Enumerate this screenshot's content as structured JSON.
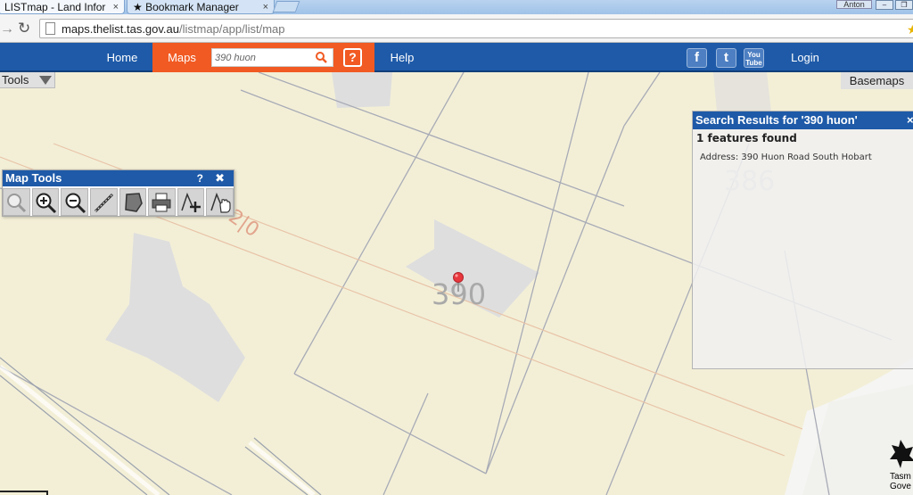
{
  "browser": {
    "tabs": [
      {
        "label": "LISTmap - Land Infor",
        "close": "×"
      },
      {
        "label": "★ Bookmark Manager",
        "close": "×"
      }
    ],
    "user_label": "Anton",
    "window_buttons": [
      "–",
      "❐"
    ],
    "url_host": "maps.thelist.tas.gov.au",
    "url_path": "/listmap/app/list/map"
  },
  "nav": {
    "home": "Home",
    "maps": "Maps",
    "search_value": "390 huon",
    "help_icon": "?",
    "help": "Help",
    "facebook": "f",
    "twitter": "t",
    "youtube": "You Tube",
    "login": "Login"
  },
  "map": {
    "tools_label": "Tools",
    "basemaps_label": "Basemaps",
    "labels": [
      "390",
      "386",
      "2|0"
    ],
    "corner_text": "Tasm\nGove"
  },
  "map_tools": {
    "title": "Map Tools",
    "help": "?",
    "close": "✖",
    "tools": [
      "identify-tool-icon",
      "zoom-in-icon",
      "zoom-out-icon",
      "measure-tool-icon",
      "polygon-tool-icon",
      "print-icon",
      "add-annotation-icon",
      "pan-hand-icon"
    ]
  },
  "search_results": {
    "title": "Search Results for '390 huon'",
    "close": "×",
    "count_text": "1 features found",
    "address_text": "Address: 390 Huon Road South Hobart"
  },
  "colors": {
    "nav_blue": "#1e5aa8",
    "accent_orange": "#f15a22",
    "map_cream": "#f3efd7"
  }
}
